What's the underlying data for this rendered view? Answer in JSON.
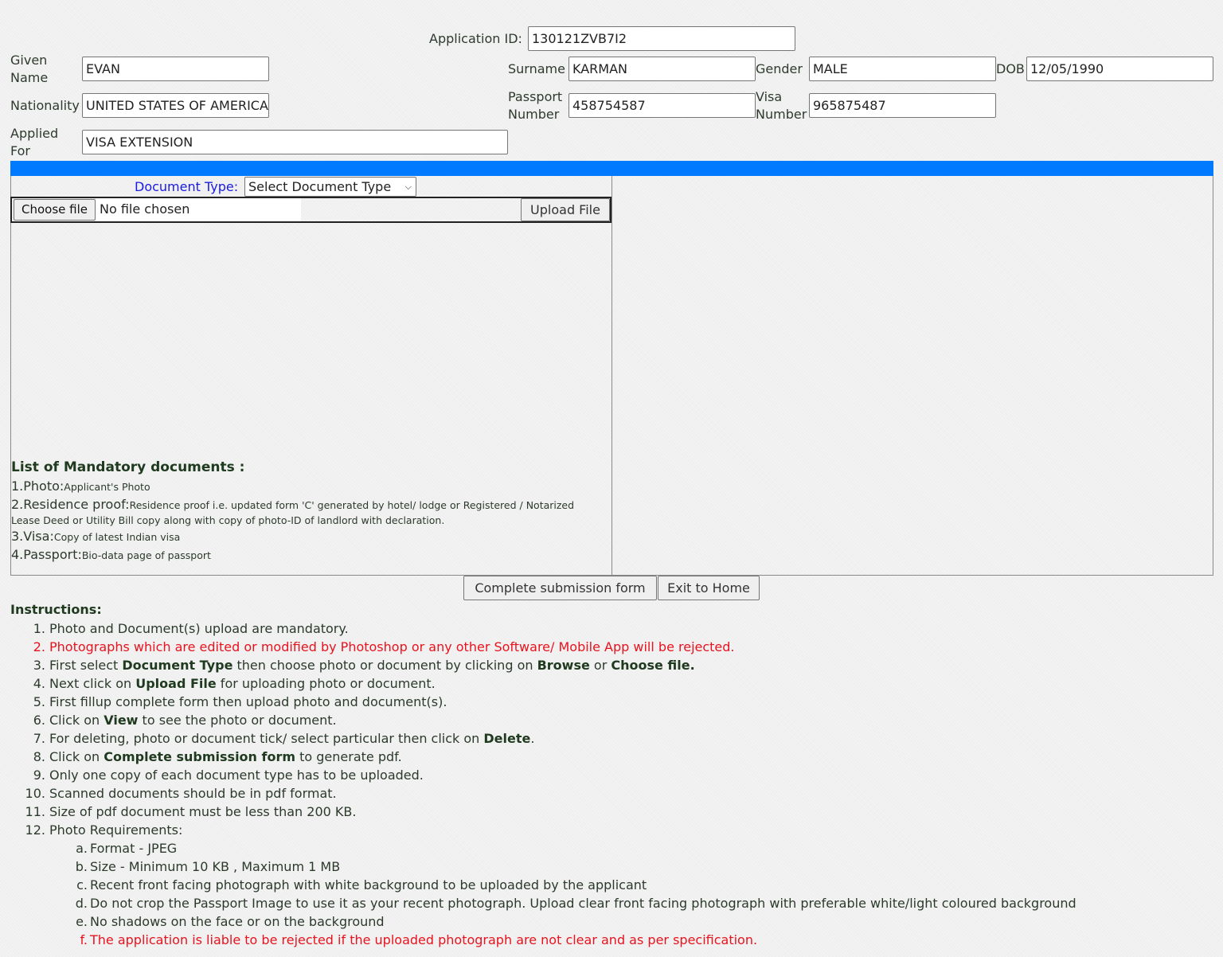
{
  "form": {
    "application_id": {
      "label": "Application ID:",
      "value": "130121ZVB7I2"
    },
    "given_name": {
      "label_line1": "Given",
      "label_line2": "Name",
      "value": "EVAN"
    },
    "surname": {
      "label": "Surname",
      "value": "KARMAN"
    },
    "gender": {
      "label": "Gender",
      "value": "MALE"
    },
    "dob": {
      "label": "DOB",
      "value": "12/05/1990"
    },
    "nationality": {
      "label": "Nationality",
      "value": "UNITED STATES OF AMERICA"
    },
    "passport_number": {
      "label_line1": "Passport",
      "label_line2": "Number",
      "value": "458754587"
    },
    "visa_number": {
      "label_line1": "Visa",
      "label_line2": "Number",
      "value": "965875487"
    },
    "applied_for": {
      "label_line1": "Applied",
      "label_line2": "For",
      "value": "VISA EXTENSION"
    }
  },
  "upload": {
    "document_type_label": "Document Type:",
    "document_type_selected": "Select Document Type",
    "choose_file_label": "Choose file",
    "file_status": "No file chosen",
    "upload_button": "Upload File"
  },
  "mandatory_documents": {
    "title": "List of Mandatory documents :",
    "items": [
      {
        "key": "1.Photo:",
        "desc": "Applicant's Photo"
      },
      {
        "key": "2.Residence proof:",
        "desc": "Residence proof i.e. updated form 'C' generated by hotel/ lodge or Registered / Notarized Lease Deed or Utility Bill copy along with copy of photo-ID of landlord with declaration."
      },
      {
        "key": "3.Visa:",
        "desc": "Copy of latest Indian visa"
      },
      {
        "key": "4.Passport:",
        "desc": "Bio-data page of passport"
      }
    ]
  },
  "actions": {
    "complete_submission": "Complete submission form",
    "exit_home": "Exit to Home"
  },
  "instructions": {
    "title": "Instructions:",
    "items": [
      {
        "num": "1.",
        "parts": [
          {
            "t": "Photo and Document(s) upload are mandatory."
          }
        ]
      },
      {
        "num": "2.",
        "red": true,
        "parts": [
          {
            "t": "Photographs which are edited or modified by Photoshop or any other Software/ Mobile App will be rejected."
          }
        ]
      },
      {
        "num": "3.",
        "parts": [
          {
            "t": "First select "
          },
          {
            "t": "Document Type",
            "b": true
          },
          {
            "t": " then choose photo or document by clicking on "
          },
          {
            "t": "Browse",
            "b": true
          },
          {
            "t": " or "
          },
          {
            "t": "Choose file.",
            "b": true
          }
        ]
      },
      {
        "num": "4.",
        "parts": [
          {
            "t": "Next click on "
          },
          {
            "t": "Upload File",
            "b": true
          },
          {
            "t": " for uploading photo or document."
          }
        ]
      },
      {
        "num": "5.",
        "parts": [
          {
            "t": "First fillup complete form then upload photo and document(s)."
          }
        ]
      },
      {
        "num": "6.",
        "parts": [
          {
            "t": "Click on "
          },
          {
            "t": "View",
            "b": true
          },
          {
            "t": " to see the photo or document."
          }
        ]
      },
      {
        "num": "7.",
        "parts": [
          {
            "t": "For deleting, photo or document tick/ select particular then click on "
          },
          {
            "t": "Delete",
            "b": true
          },
          {
            "t": "."
          }
        ]
      },
      {
        "num": "8.",
        "parts": [
          {
            "t": "Click on "
          },
          {
            "t": "Complete submission form",
            "b": true
          },
          {
            "t": " to generate pdf."
          }
        ]
      },
      {
        "num": "9.",
        "parts": [
          {
            "t": "Only one copy of each document type has to be uploaded."
          }
        ]
      },
      {
        "num": "10.",
        "parts": [
          {
            "t": "Scanned documents should be in pdf format."
          }
        ]
      },
      {
        "num": "11.",
        "parts": [
          {
            "t": "Size of pdf document must be less than 200 KB."
          }
        ]
      },
      {
        "num": "12.",
        "parts": [
          {
            "t": "Photo Requirements:"
          }
        ]
      }
    ],
    "photo_requirements": [
      {
        "num": "a.",
        "text": "Format - JPEG"
      },
      {
        "num": "b.",
        "text": "Size - Minimum 10 KB , Maximum 1 MB"
      },
      {
        "num": "c.",
        "text": "Recent front facing photograph with white background to be uploaded by the applicant"
      },
      {
        "num": "d.",
        "text": "Do not crop the Passport Image to use it as your recent photograph. Upload clear front facing photograph with preferable white/light coloured background"
      },
      {
        "num": "e.",
        "text": "No shadows on the face or on the background"
      },
      {
        "num": "f.",
        "text": "The application is liable to be rejected if the uploaded photograph are not clear and as per specification.",
        "red": true
      }
    ]
  },
  "colors": {
    "accent_bar": "#007bff",
    "warning_text": "#e8131e",
    "doc_type_label": "#1a1ae6"
  }
}
